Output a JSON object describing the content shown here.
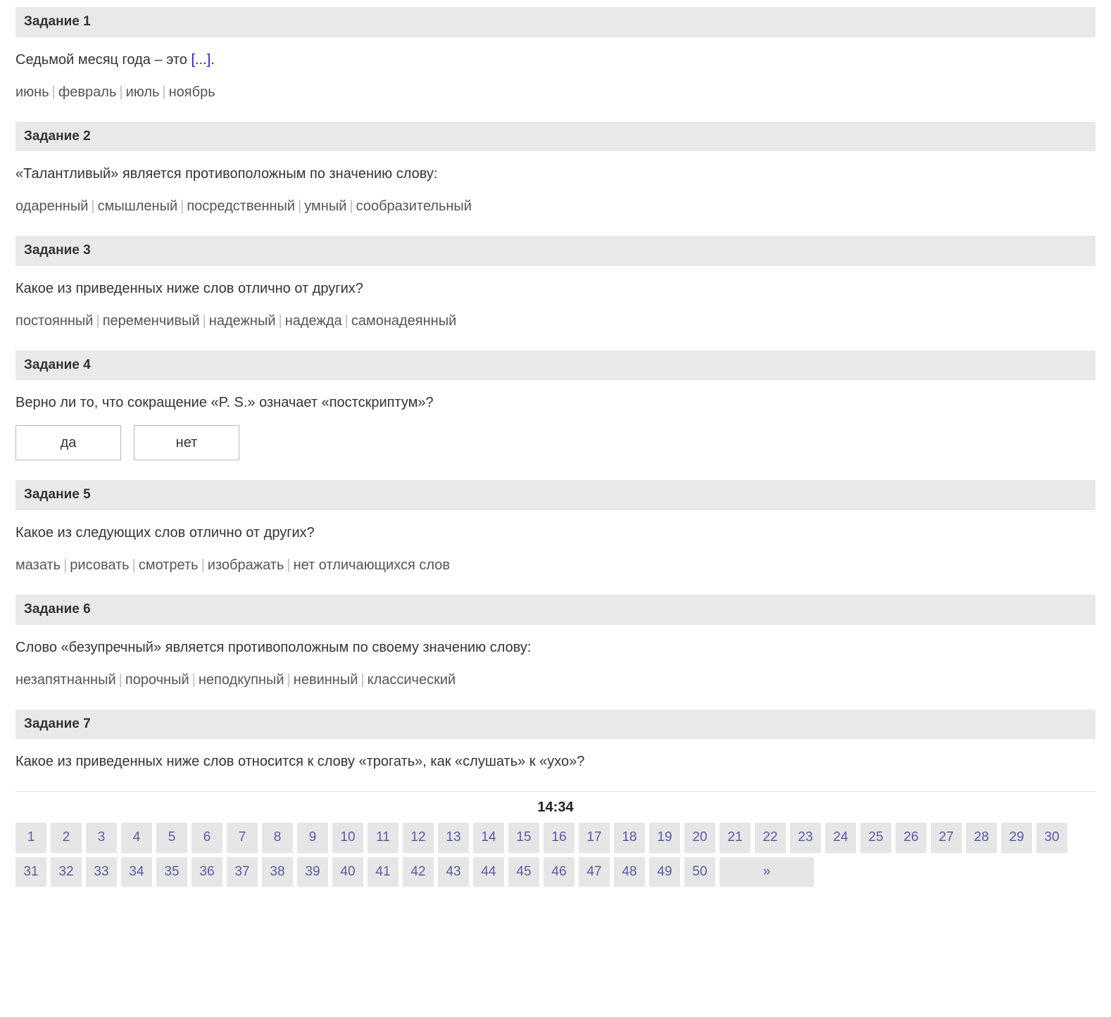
{
  "tasks": [
    {
      "title": "Задание 1",
      "prompt_pre": "Седьмой месяц года – это ",
      "blank": "[...]",
      "prompt_post": ".",
      "options": [
        "июнь",
        "февраль",
        "июль",
        "ноябрь"
      ]
    },
    {
      "title": "Задание 2",
      "prompt_pre": "«Талантливый» является противоположным по значению слову:",
      "options": [
        "одаренный",
        "смышленый",
        "посредственный",
        "умный",
        "сообразительный"
      ]
    },
    {
      "title": "Задание 3",
      "prompt_pre": "Какое из приведенных ниже слов отлично от других?",
      "options": [
        "постоянный",
        "переменчивый",
        "надежный",
        "надежда",
        "самонадеянный"
      ]
    },
    {
      "title": "Задание 4",
      "prompt_pre": "Верно ли то, что сокращение «P. S.» означает «постскриптум»?",
      "yes": "да",
      "no": "нет"
    },
    {
      "title": "Задание 5",
      "prompt_pre": "Какое из следующих слов отлично от других?",
      "options": [
        "мазать",
        "рисовать",
        "смотреть",
        "изображать",
        "нет отличающихся слов"
      ]
    },
    {
      "title": "Задание 6",
      "prompt_pre": "Слово «безупречный» является противоположным по своему значению слову:",
      "options": [
        "незапятнанный",
        "порочный",
        "неподкупный",
        "невинный",
        "классический"
      ]
    },
    {
      "title": "Задание 7",
      "prompt_pre": "Какое из приведенных ниже слов относится к слову «трогать», как «слушать» к «ухо»?"
    }
  ],
  "timer": "14:34",
  "pager": {
    "count": 50,
    "next_label": "»"
  }
}
